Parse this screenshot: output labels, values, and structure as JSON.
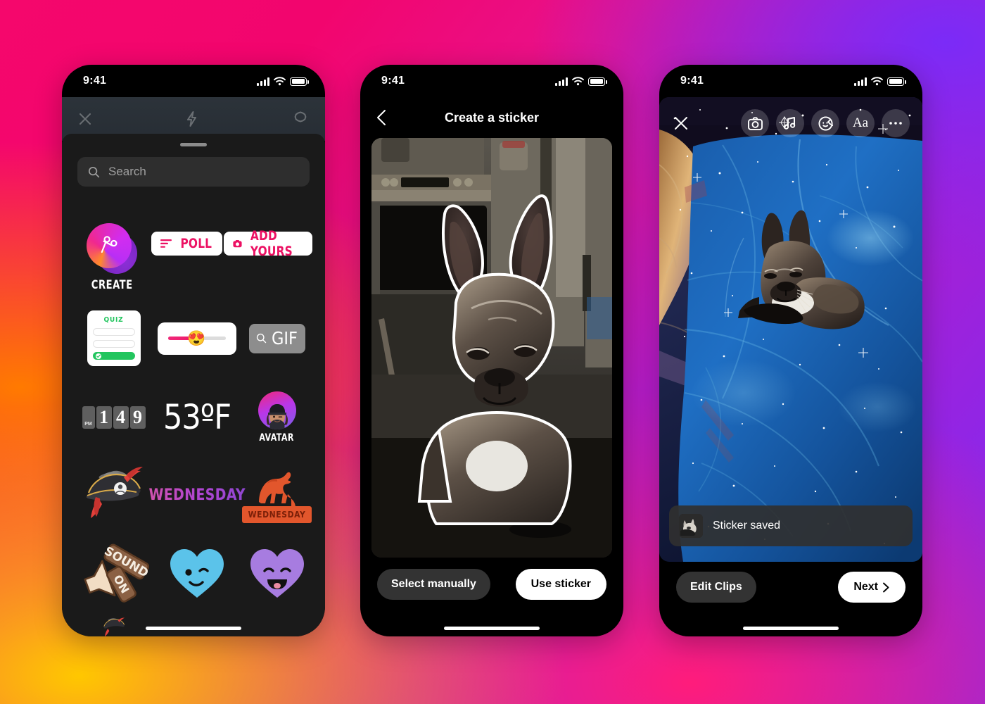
{
  "background": {
    "gradient_colors": [
      "#F5076C",
      "#FF7A00",
      "#FFC700",
      "#FF1C7B",
      "#7B2BF7"
    ]
  },
  "phones": {
    "sticker_tray": {
      "status_bar": {
        "time": "9:41",
        "signal_icon": "cellular-bars-icon",
        "wifi_icon": "wifi-icon",
        "battery_icon": "battery-icon"
      },
      "camera_bar": {
        "close_icon": "close-icon",
        "flash_icon": "flash-icon",
        "settings_icon": "settings-icon"
      },
      "search": {
        "placeholder": "Search",
        "icon": "search-icon"
      },
      "stickers": {
        "create": {
          "label": "CREATE",
          "icon": "scissors-icon"
        },
        "poll": {
          "label": "POLL",
          "icon": "poll-bars-icon"
        },
        "add_yours": {
          "label": "ADD YOURS",
          "icon": "camera-icon"
        },
        "quiz": {
          "label": "QUIZ"
        },
        "slider": {
          "emoji": "😍"
        },
        "gif": {
          "label": "GIF",
          "icon": "search-icon"
        },
        "clock": {
          "ampm": "PM",
          "digits": [
            "1",
            "4",
            "9"
          ]
        },
        "temperature": {
          "label": "53ºF"
        },
        "avatar": {
          "label": "AVATAR"
        },
        "pirate_hat": {
          "name": "pirate-hat-sticker"
        },
        "wednesday_text": {
          "label": "WEDNESDAY"
        },
        "camel": {
          "label": "WEDNESDAY",
          "name": "camel-sticker"
        },
        "sound_on": {
          "label": "SOUND ON"
        },
        "heart_blue": {
          "name": "blue-winking-heart-sticker"
        },
        "heart_purple": {
          "name": "purple-smiling-heart-sticker"
        }
      }
    },
    "create_sticker": {
      "status_bar": {
        "time": "9:41"
      },
      "header": {
        "title": "Create a sticker",
        "back_icon": "chevron-left-icon"
      },
      "photo": {
        "subject": "french-bulldog-cutout",
        "scene": "kitchen"
      },
      "footer": {
        "secondary_button": "Select manually",
        "primary_button": "Use sticker"
      }
    },
    "story_editor": {
      "status_bar": {
        "time": "9:41"
      },
      "toolbar": {
        "close_icon": "close-icon",
        "items": [
          {
            "icon": "camera-icon",
            "name": "camera-tool"
          },
          {
            "icon": "music-note-icon",
            "name": "music-tool"
          },
          {
            "icon": "sticker-face-icon",
            "name": "sticker-tool"
          },
          {
            "icon": "text-aa-icon",
            "label": "Aa",
            "name": "text-tool"
          },
          {
            "icon": "more-dots-icon",
            "name": "more-tool"
          }
        ]
      },
      "canvas": {
        "background": "starry-galaxy-blue-bedspread",
        "placed_sticker": "french-bulldog-sticker"
      },
      "toast": {
        "label": "Sticker saved",
        "thumbnail": "dog-sticker-thumbnail"
      },
      "footer": {
        "secondary_button": "Edit Clips",
        "primary_button": "Next",
        "primary_icon": "chevron-right-icon"
      }
    }
  }
}
